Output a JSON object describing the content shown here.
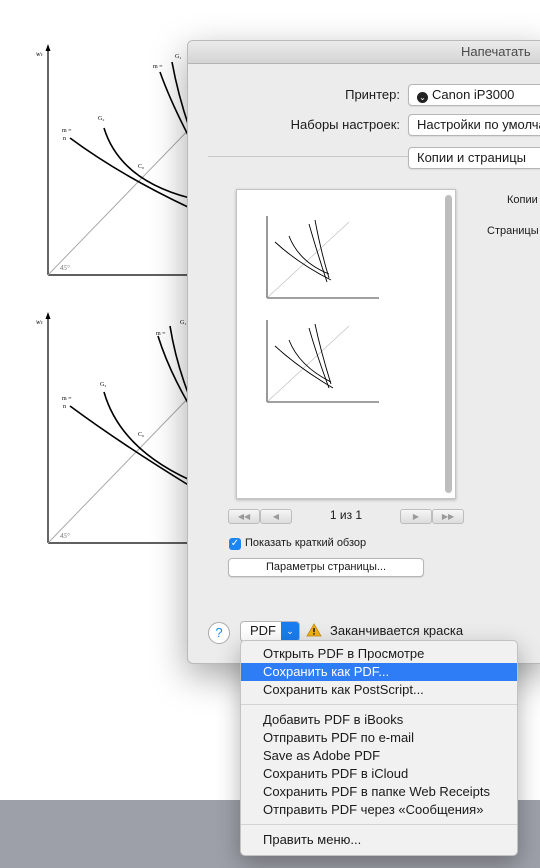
{
  "document": {
    "figures": [
      {
        "y_axis_label": "wₜ",
        "curve_labels": [
          "G₁",
          "m =",
          "G₂",
          "m =",
          "n",
          "C₀"
        ],
        "angle_label": "45°"
      },
      {
        "y_axis_label": "wₜ",
        "curve_labels": [
          "G₁",
          "m =",
          "G₂",
          "m =",
          "n",
          "C₀"
        ],
        "angle_label": "45°"
      }
    ]
  },
  "dialog": {
    "title": "Напечатать",
    "printer_label": "Принтер:",
    "printer_value": "Canon iP3000",
    "presets_label": "Наборы настроек:",
    "presets_value": "Настройки по умолчанию",
    "section_value": "Копии и страницы",
    "copies_label": "Копии",
    "pages_label": "Страницы",
    "page_count": "1 из 1",
    "show_summary_label": "Показать краткий обзор",
    "page_setup_button": "Параметры страницы...",
    "help_label": "?",
    "pdf_button": "PDF",
    "warning_text": "Заканчивается краска"
  },
  "pdf_menu": {
    "items": [
      "Открыть PDF в Просмотре",
      "Сохранить как PDF...",
      "Сохранить как PostScript...",
      "Добавить PDF в iBooks",
      "Отправить PDF по e-mail",
      "Save as Adobe PDF",
      "Сохранить PDF в iCloud",
      "Сохранить PDF в папке Web Receipts",
      "Отправить PDF через «Сообщения»",
      "Править меню..."
    ],
    "selected": "Сохранить как PDF..."
  },
  "icons": {
    "printer_status": "printer-status-icon",
    "warning": "warning-triangle-icon",
    "checkbox": "checkmark-icon",
    "dropdown": "chevron-down-icon"
  },
  "colors": {
    "accent": "#1b7df0",
    "menu_selection": "#2e7cf6",
    "warning": "#f3b31a"
  }
}
